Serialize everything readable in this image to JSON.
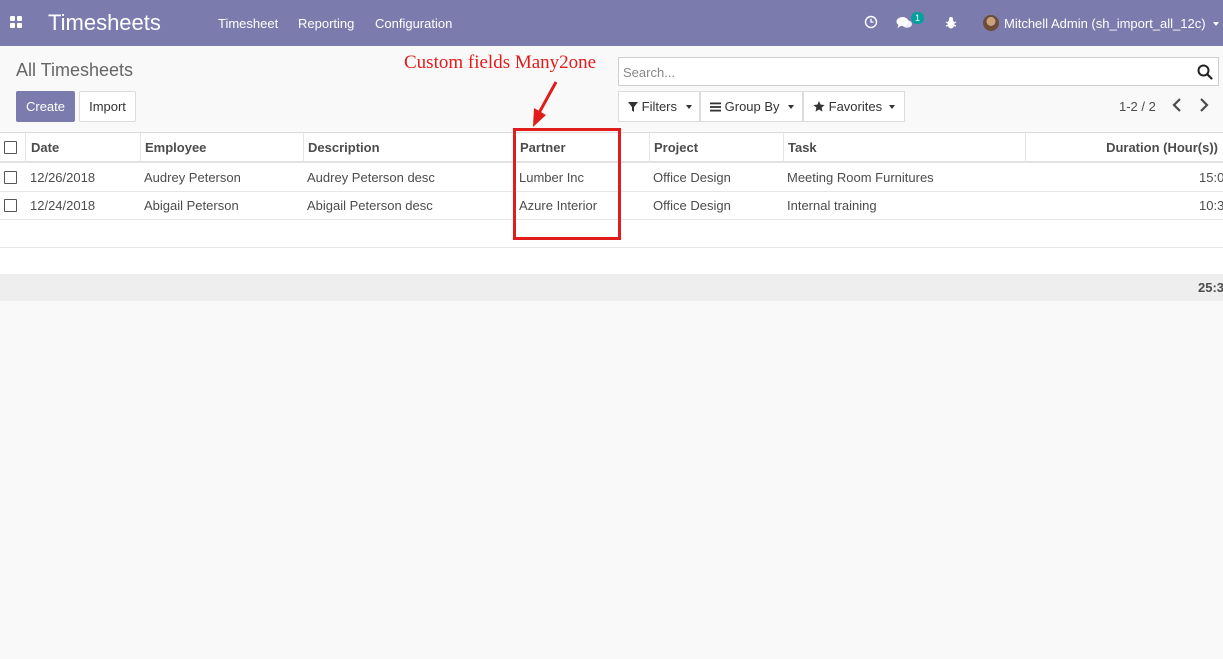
{
  "navbar": {
    "brand": "Timesheets",
    "menu": [
      "Timesheet",
      "Reporting",
      "Configuration"
    ],
    "chat_badge": "1",
    "user": "Mitchell Admin (sh_import_all_12c)",
    "background_color": "#7c7bad"
  },
  "control_panel": {
    "title": "All Timesheets",
    "create_label": "Create",
    "import_label": "Import",
    "search_placeholder": "Search...",
    "filters_label": "Filters",
    "group_by_label": "Group By",
    "favorites_label": "Favorites",
    "pager": "1-2 / 2"
  },
  "table": {
    "columns": [
      "Date",
      "Employee",
      "Description",
      "Partner",
      "Project",
      "Task",
      "Duration (Hour(s))"
    ],
    "rows": [
      [
        "12/26/2018",
        "Audrey Peterson",
        "Audrey Peterson desc",
        "Lumber Inc",
        "Office Design",
        "Meeting Room Furnitures",
        "15:0"
      ],
      [
        "12/24/2018",
        "Abigail Peterson",
        "Abigail Peterson desc",
        "Azure Interior",
        "Office Design",
        "Internal training",
        "10:3"
      ]
    ],
    "total": "25:3"
  },
  "annotation": {
    "text": "Custom fields Many2one",
    "color": "#e21b1b"
  }
}
